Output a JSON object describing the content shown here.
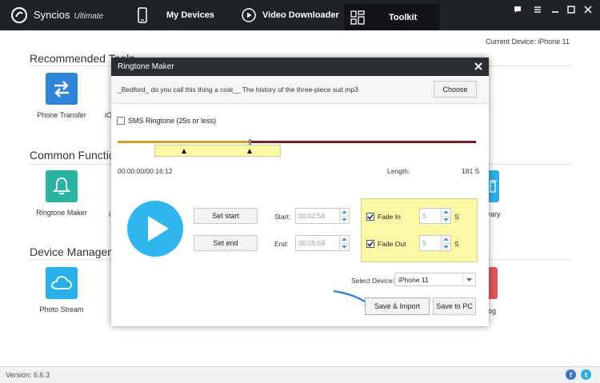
{
  "app": {
    "name": "Syncios",
    "edition": "Ultimate"
  },
  "nav": {
    "my_devices": "My Devices",
    "video_downloader": "Video Downloader",
    "toolkit": "Toolkit"
  },
  "current_device": "Current Device: iPhone 11",
  "sections": {
    "recommended": "Recommended Tools",
    "common": "Common Functions",
    "device": "Device Management"
  },
  "tools": {
    "phone_transfer": "Phone Transfer",
    "ringtone_maker": "Ringtone Maker",
    "photo_stream": "Photo Stream",
    "partial_io": "iO",
    "partial_i": "i",
    "partial_library": "rary",
    "partial_log": "og"
  },
  "status": {
    "version": "Version: 6.6.3"
  },
  "dialog": {
    "title": "Ringtone Maker",
    "file_name": "_Bedford_ do you call this thing a coat__ The history of the three-piece suit.mp3",
    "choose_label": "Choose",
    "sms_label": "SMS Ringtone (25s or less)",
    "sms_checked": false,
    "time": "00:00:00/00:16:12",
    "length_label": "Length:",
    "length_value": "181 S",
    "set_start_label": "Set start",
    "set_end_label": "Set end",
    "start_label": "Start:",
    "start_value": "00:02:58",
    "end_label": "End:",
    "end_value": "00:05:59",
    "fade_in_label": "Fade In",
    "fade_in_value": "5",
    "fade_in_checked": true,
    "fade_out_label": "Fade Out",
    "fade_out_value": "5",
    "fade_out_checked": true,
    "unit": "S",
    "select_device_label": "Select Device:",
    "selected_device": "iPhone 11",
    "save_import_label": "Save & Import",
    "save_pc_label": "Save to PC"
  },
  "colors": {
    "topbar": "#1f2328",
    "accent_blue": "#2fb6ef",
    "phone_transfer": "#2f86d8",
    "ringtone_maker": "#2bb3a1",
    "photo_stream": "#29b0ea",
    "highlight_yellow": "#fbf8a6",
    "track_selected": "#c9a227",
    "track_rest": "#6b2323"
  }
}
